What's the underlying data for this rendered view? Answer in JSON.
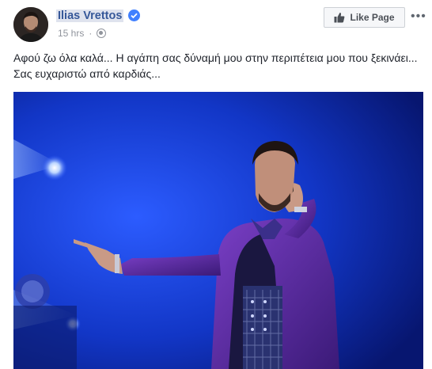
{
  "post": {
    "author": "Ilias Vrettos",
    "time": "15 hrs",
    "dot": "·",
    "like_button": "Like Page",
    "more": "•••",
    "text": "Αφού ζω όλα καλά... Η αγάπη σας δύναμή μου στην περιπέτεια μου που ξεκινάει... Σας ευχαριστώ από καρδιάς..."
  },
  "icons": {
    "verified": "verified-badge-icon",
    "privacy": "globe-icon",
    "like": "thumbs-up-icon",
    "more": "more-options-icon"
  },
  "colors": {
    "link": "#365899",
    "verified": "#4080ff",
    "stage": "#1a3fd6"
  }
}
